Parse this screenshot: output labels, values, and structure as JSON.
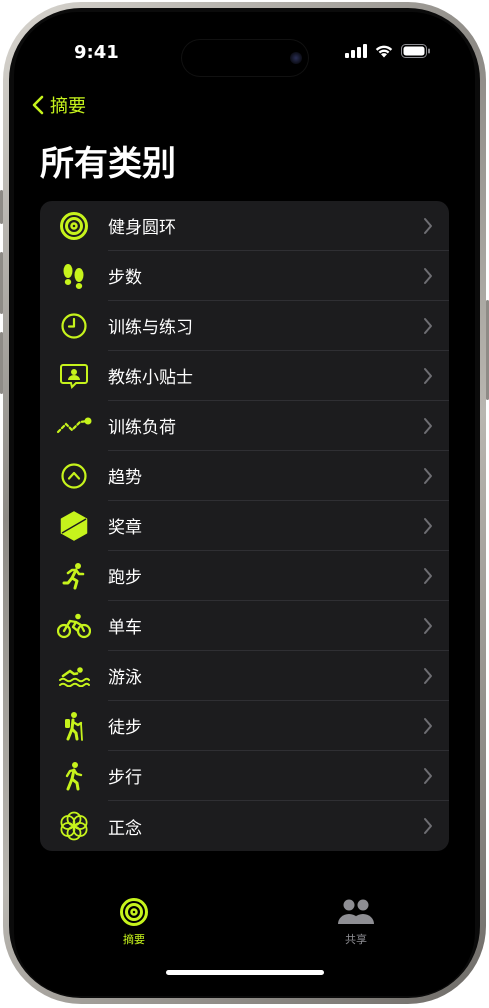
{
  "status_bar": {
    "time": "9:41"
  },
  "nav": {
    "back_label": "摘要"
  },
  "page": {
    "title": "所有类别"
  },
  "categories": [
    {
      "label": "健身圆环",
      "icon": "activity-rings-icon"
    },
    {
      "label": "步数",
      "icon": "footprints-icon"
    },
    {
      "label": "训练与练习",
      "icon": "clock-icon"
    },
    {
      "label": "教练小贴士",
      "icon": "coaching-tip-icon"
    },
    {
      "label": "训练负荷",
      "icon": "training-load-icon"
    },
    {
      "label": "趋势",
      "icon": "trend-arrow-icon"
    },
    {
      "label": "奖章",
      "icon": "award-hexagon-icon"
    },
    {
      "label": "跑步",
      "icon": "running-figure-icon"
    },
    {
      "label": "单车",
      "icon": "cycling-figure-icon"
    },
    {
      "label": "游泳",
      "icon": "swimming-figure-icon"
    },
    {
      "label": "徒步",
      "icon": "hiking-figure-icon"
    },
    {
      "label": "步行",
      "icon": "walking-figure-icon"
    },
    {
      "label": "正念",
      "icon": "mindfulness-flower-icon"
    }
  ],
  "tab_bar": {
    "items": [
      {
        "label": "摘要",
        "icon": "summary-rings-icon",
        "selected": true
      },
      {
        "label": "共享",
        "icon": "sharing-people-icon",
        "selected": false
      }
    ]
  },
  "colors": {
    "accent": "#C6F31C",
    "background": "#000000",
    "row_background": "#1C1C1E",
    "separator": "#2F2F33",
    "chevron": "#6E6E73",
    "tab_inactive": "#8E8E93"
  }
}
